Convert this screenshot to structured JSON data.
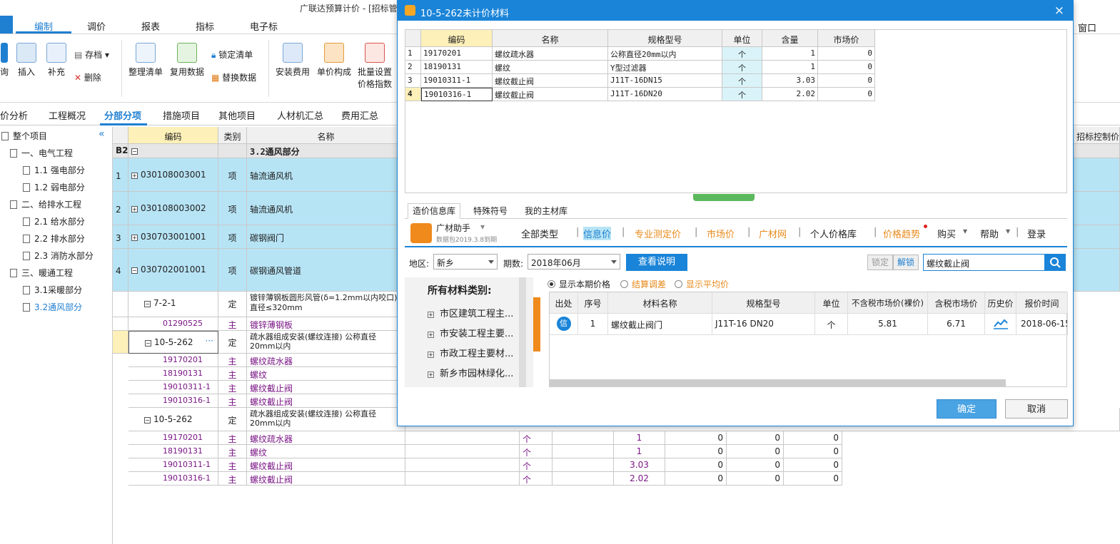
{
  "app_title": "广联达预算计价 - [招标管",
  "ribbon_tabs": [
    "编制",
    "调价",
    "报表",
    "指标",
    "电子标"
  ],
  "window_menu": "窗口",
  "ribbon": {
    "lookup": "询",
    "insert": "插入",
    "supplement": "补充",
    "archive": "存档",
    "delete": "删除",
    "organize_list": "整理清单",
    "reuse_data": "复用数据",
    "lock_list": "锁定清单",
    "replace_data": "替换数据",
    "install_fee": "安装费用",
    "unit_price": "单价构成",
    "batch_price_1": "批量设置",
    "batch_price_2": "价格指数"
  },
  "tabs2": [
    "价分析",
    "工程概况",
    "分部分项",
    "措施项目",
    "其他项目",
    "人材机汇总",
    "费用汇总"
  ],
  "right_header": "招标控制价",
  "tree": {
    "root": "整个项目",
    "nodes": [
      "一、电气工程",
      "1.1 强电部分",
      "1.2 弱电部分",
      "二、给排水工程",
      "2.1 给水部分",
      "2.2 排水部分",
      "2.3 消防水部分",
      "三、暖通工程",
      "3.1采暖部分",
      "3.2通风部分"
    ]
  },
  "grid": {
    "headers": {
      "code": "编码",
      "type": "类别",
      "name": "名称"
    },
    "rows": [
      {
        "no": "B2",
        "code": "",
        "type": "",
        "name": "3.2通风部分"
      },
      {
        "no": "1",
        "code": "030108003001",
        "type": "项",
        "name": "轴流通风机"
      },
      {
        "no": "2",
        "code": "030108003002",
        "type": "项",
        "name": "轴流通风机"
      },
      {
        "no": "3",
        "code": "030703001001",
        "type": "项",
        "name": "碳钢阀门"
      },
      {
        "no": "4",
        "code": "030702001001",
        "type": "项",
        "name": "碳钢通风管道"
      },
      {
        "no": "",
        "code": "7-2-1",
        "type": "定",
        "name": "镀锌薄钢板圆形风管(δ=1.2mm以内咬口)",
        "name2": "直径≤320mm"
      },
      {
        "no": "",
        "code": "01290525",
        "type": "主",
        "name": "镀锌薄钢板"
      },
      {
        "no": "",
        "code": "10-5-262",
        "type": "定",
        "name": "疏水器组成安装(螺纹连接) 公称直径",
        "name2": "20mm以内"
      },
      {
        "no": "",
        "code": "19170201",
        "type": "主",
        "name": "螺纹疏水器"
      },
      {
        "no": "",
        "code": "18190131",
        "type": "主",
        "name": "螺纹"
      },
      {
        "no": "",
        "code": "19010311-1",
        "type": "主",
        "name": "螺纹截止阀"
      },
      {
        "no": "",
        "code": "19010316-1",
        "type": "主",
        "name": "螺纹截止阀"
      },
      {
        "no": "",
        "code": "10-5-262",
        "type": "定",
        "name": "疏水器组成安装(螺纹连接) 公称直径",
        "name2": "20mm以内"
      },
      {
        "no": "",
        "code": "19170201",
        "type": "主",
        "name": "螺纹疏水器",
        "unit": "个",
        "qty": "1",
        "v1": "0",
        "v2": "0",
        "v3": "0"
      },
      {
        "no": "",
        "code": "18190131",
        "type": "主",
        "name": "螺纹",
        "unit": "个",
        "qty": "1",
        "v1": "0",
        "v2": "0",
        "v3": "0"
      },
      {
        "no": "",
        "code": "19010311-1",
        "type": "主",
        "name": "螺纹截止阀",
        "unit": "个",
        "qty": "3.03",
        "v1": "0",
        "v2": "0",
        "v3": "0"
      },
      {
        "no": "",
        "code": "19010316-1",
        "type": "主",
        "name": "螺纹截止阀",
        "unit": "个",
        "qty": "2.02",
        "v1": "0",
        "v2": "0",
        "v3": "0"
      }
    ],
    "ellipsis": "···"
  },
  "dialog": {
    "title": "10-5-262未计价材料",
    "close": "×",
    "table_headers": [
      "编码",
      "名称",
      "规格型号",
      "单位",
      "含量",
      "市场价"
    ],
    "materials": [
      {
        "no": "1",
        "code": "19170201",
        "name": "螺纹疏水器",
        "spec": "公称直径20mm以内",
        "unit": "个",
        "qty": "1",
        "price": "0"
      },
      {
        "no": "2",
        "code": "18190131",
        "name": "螺纹",
        "spec": "Y型过滤器",
        "unit": "个",
        "qty": "1",
        "price": "0"
      },
      {
        "no": "3",
        "code": "19010311-1",
        "name": "螺纹截止阀",
        "spec": "J11T-16DN15",
        "unit": "个",
        "qty": "3.03",
        "price": "0"
      },
      {
        "no": "4",
        "code": "19010316-1",
        "name": "螺纹截止阀",
        "spec": "J11T-16DN20",
        "unit": "个",
        "qty": "2.02",
        "price": "0"
      }
    ],
    "lib_tabs": [
      "造价信息库",
      "特殊符号",
      "我的主材库"
    ],
    "assistant_name": "广材助手",
    "assistant_sub": "数据包2019.3.8到期",
    "nav": [
      "全部类型",
      "信息价",
      "专业测定价",
      "市场价",
      "广材网",
      "个人价格库",
      "价格趋势",
      "购买",
      "帮助",
      "登录"
    ],
    "nav_sep": "|",
    "region_label": "地区:",
    "region_value": "新乡",
    "period_label": "期数:",
    "period_value": "2018年06月",
    "explain_btn": "查看说明",
    "lock_btn": "锁定",
    "unlock_btn": "解锁",
    "search_value": "螺纹截止阀",
    "categories_title": "所有材料类别:",
    "categories": [
      "市区建筑工程主...",
      "市安装工程主要...",
      "市政工程主要材...",
      "新乡市园林绿化..."
    ],
    "radios": [
      "显示本期价格",
      "结算调差",
      "显示平均价"
    ],
    "price_headers": [
      "出处",
      "序号",
      "材料名称",
      "规格型号",
      "单位",
      "不含税市场价(裸价)",
      "含税市场价",
      "历史价",
      "报价时间"
    ],
    "price_rows": [
      {
        "src": "信",
        "no": "1",
        "name": "螺纹截止阀门",
        "spec": "J11T-16  DN20",
        "unit": "个",
        "price_ex": "5.81",
        "price_in": "6.71",
        "date": "2018-06-15"
      }
    ],
    "ok": "确定",
    "cancel": "取消"
  }
}
